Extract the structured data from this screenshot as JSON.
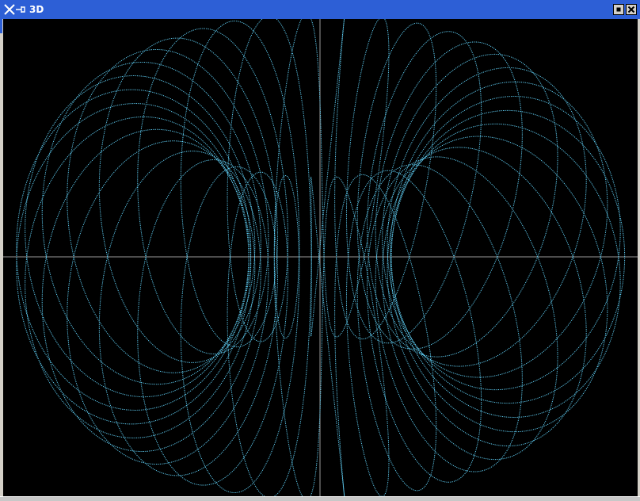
{
  "window": {
    "title": "3D",
    "icons": [
      "x-logo-icon",
      "pin-icon",
      "maximize-icon",
      "close-icon"
    ]
  },
  "plot": {
    "background": "#000000",
    "curve_color": "#5ecbf0",
    "axis_color": "#9a9a9a",
    "shape": "torus-knot-wireframe"
  },
  "colors": {
    "titlebar": "#2d5fd6",
    "frame": "#d4d0c8"
  }
}
